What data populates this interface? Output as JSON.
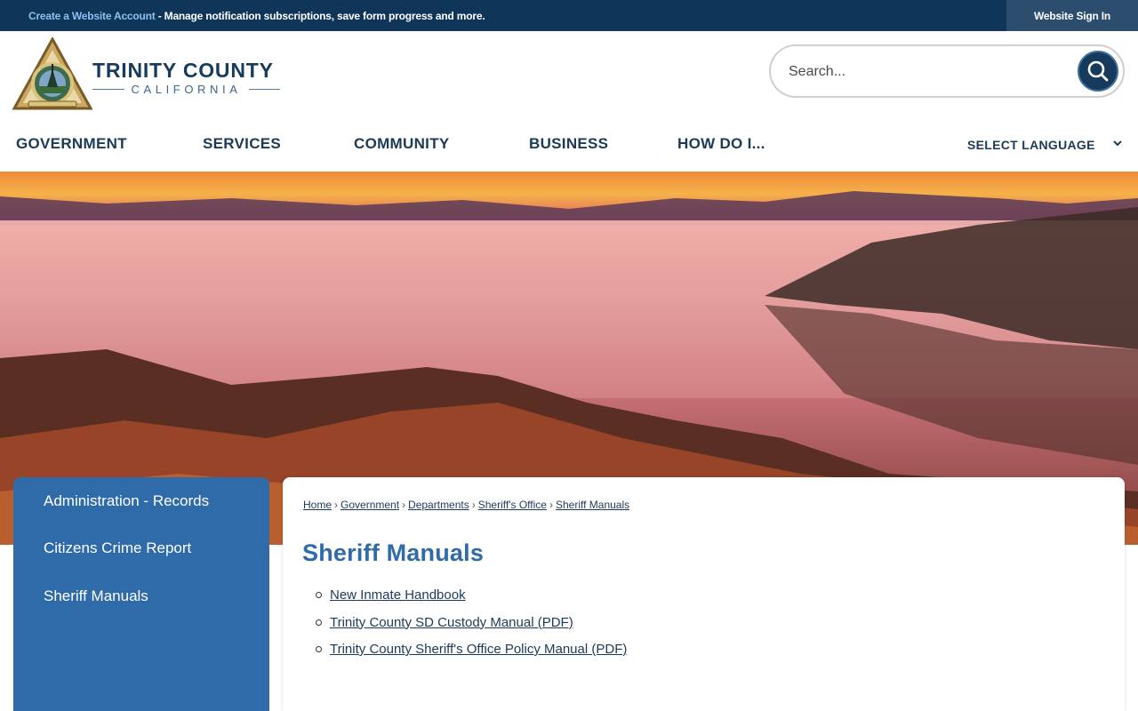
{
  "topbar": {
    "create_account_link": "Create a Website Account",
    "message": " - Manage notification subscriptions, save form progress and more.",
    "signin_label": "Website Sign In"
  },
  "brand": {
    "name": "TRINITY COUNTY",
    "subtitle": "CALIFORNIA",
    "seal_icon": "county-seal"
  },
  "search": {
    "placeholder": "Search...",
    "icon": "search-icon"
  },
  "nav": {
    "items": [
      {
        "label": "GOVERNMENT"
      },
      {
        "label": "SERVICES"
      },
      {
        "label": "COMMUNITY"
      },
      {
        "label": "BUSINESS"
      },
      {
        "label": "HOW DO I..."
      }
    ],
    "language_label": "SELECT LANGUAGE"
  },
  "sidebar": {
    "items": [
      {
        "label": "Administration - Records"
      },
      {
        "label": "Citizens Crime Report"
      },
      {
        "label": "Sheriff Manuals"
      }
    ]
  },
  "breadcrumb": {
    "items": [
      "Home",
      "Government",
      "Departments",
      "Sheriff's Office",
      "Sheriff Manuals"
    ],
    "separator": "›"
  },
  "page": {
    "title": "Sheriff Manuals",
    "documents": [
      {
        "label": "New Inmate Handbook"
      },
      {
        "label": "Trinity County SD Custody Manual (PDF)"
      },
      {
        "label": "Trinity County Sheriff's Office Policy Manual (PDF)"
      }
    ]
  },
  "colors": {
    "topbar": "#0f3558",
    "brand_navy": "#173b5e",
    "accent_blue": "#2f6aa9",
    "link_blue": "#8cc0f0"
  }
}
